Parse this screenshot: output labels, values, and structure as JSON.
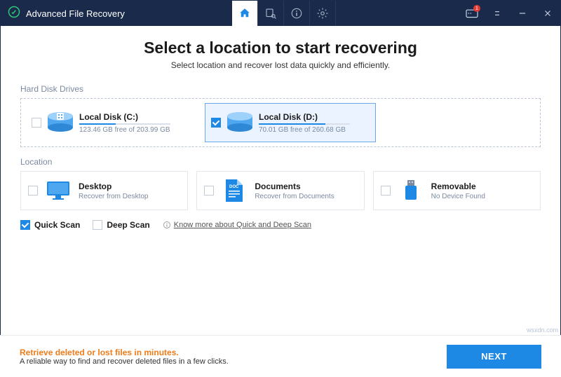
{
  "titlebar": {
    "app_name": "Advanced File Recovery",
    "notif_count": "1"
  },
  "header": {
    "title": "Select a location to start recovering",
    "subtitle": "Select location and recover lost data quickly and efficiently."
  },
  "sections": {
    "drives_label": "Hard Disk Drives",
    "location_label": "Location"
  },
  "drives": [
    {
      "name": "Local Disk (C:)",
      "free": "123.46 GB free of 203.99 GB",
      "pct": 40
    },
    {
      "name": "Local Disk (D:)",
      "free": "70.01 GB free of 260.68 GB",
      "pct": 73
    }
  ],
  "locations": [
    {
      "name": "Desktop",
      "sub": "Recover from Desktop"
    },
    {
      "name": "Documents",
      "sub": "Recover from Documents"
    },
    {
      "name": "Removable",
      "sub": "No Device Found"
    }
  ],
  "scan": {
    "quick_label": "Quick Scan",
    "deep_label": "Deep Scan",
    "know_more": "Know more about Quick and Deep Scan"
  },
  "footer": {
    "line1": "Retrieve deleted or lost files in minutes.",
    "line2": "A reliable way to find and recover deleted files in a few clicks.",
    "next": "NEXT"
  },
  "watermark": "wsxdn.com"
}
